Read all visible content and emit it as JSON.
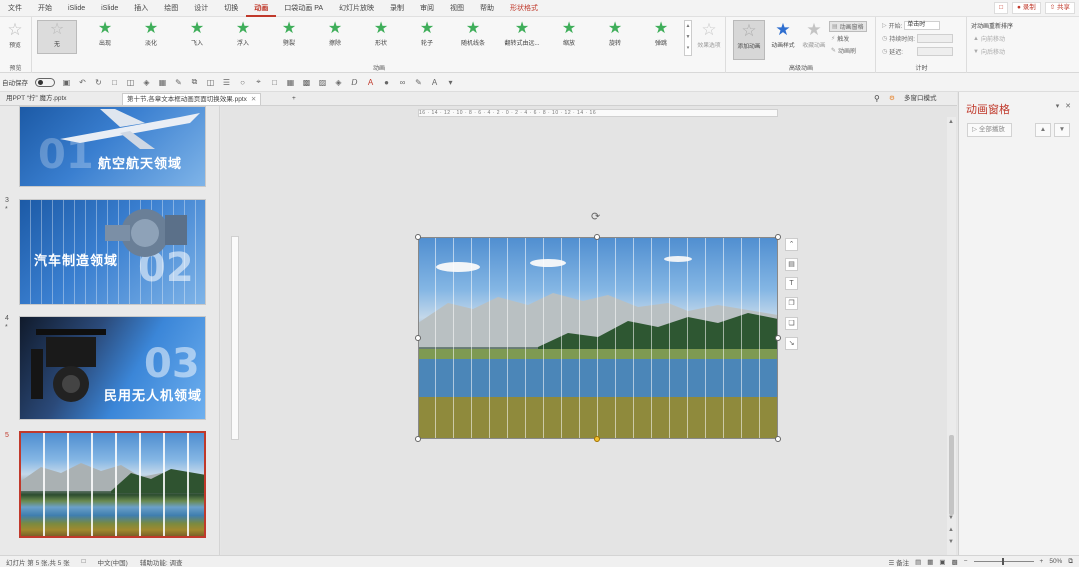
{
  "menu": {
    "tabs": [
      "文件",
      "开始",
      "iSlide",
      "iSlide",
      "插入",
      "绘图",
      "设计",
      "切换",
      "动画",
      "口袋动画 PA",
      "幻灯片放映",
      "录制",
      "审阅",
      "视图",
      "帮助",
      "形状格式"
    ],
    "active_tab": "动画",
    "comment_icon": "comment-icon",
    "record_label": "录制",
    "share_label": "共享"
  },
  "ribbon": {
    "preview_label": "预览",
    "preview_group": "预览",
    "animations": [
      "无",
      "出现",
      "淡化",
      "飞入",
      "浮入",
      "劈裂",
      "擦除",
      "形状",
      "轮子",
      "随机线条",
      "翻转式由远...",
      "缩放",
      "旋转",
      "弹跳"
    ],
    "effect_options_label": "效果选项",
    "animation_group": "动画",
    "add_animation_label": "添加动画",
    "animation_styles_label": "动画样式",
    "collect_animation_label": "收藏动画",
    "animation_pane_label": "动画窗格",
    "trigger_label": "触发",
    "animation_painter_label": "动画刷",
    "advanced_group": "高级动画",
    "start_label": "开始:",
    "start_value": "单击时",
    "duration_label": "持续时间:",
    "delay_label": "延迟:",
    "timing_group": "计时",
    "reorder_label": "对动画重新排序",
    "move_earlier_label": "向前移动",
    "move_later_label": "向后移动",
    "accent": "#c0392b"
  },
  "qat": {
    "autosave_label": "自动保存",
    "autosave_state": "关"
  },
  "doc_tabs": [
    {
      "label": "用PPT “拧” 魔方.pptx",
      "active": false
    },
    {
      "label": "第十节,各章文本框动画页面切换效果.pptx",
      "active": true
    }
  ],
  "thumbnails": [
    {
      "num": "",
      "big_num": "01",
      "caption": "航空航天领域",
      "active": false
    },
    {
      "num": "3",
      "big_num": "02",
      "caption": "汽车制造领域",
      "active": false
    },
    {
      "num": "4",
      "big_num": "03",
      "caption": "民用无人机领域",
      "active": false
    },
    {
      "num": "5",
      "big_num": "",
      "caption": "",
      "active": true
    }
  ],
  "canvas": {
    "ruler_text": "16 · 14 · 12 · 10 · 8 · 6 · 4 · 2 · 0 · 2 · 4 · 6 · 8 · 10 · 12 · 14 · 16",
    "multi_window_label": "多窗口模式"
  },
  "pane": {
    "title": "动画窗格",
    "play_all_label": "全部播放"
  },
  "status": {
    "slide_info": "幻灯片 第 5 张,共 5 张",
    "language": "中文(中国)",
    "accessibility": "辅助功能: 调查",
    "notes_label": "备注",
    "zoom": "50%"
  }
}
